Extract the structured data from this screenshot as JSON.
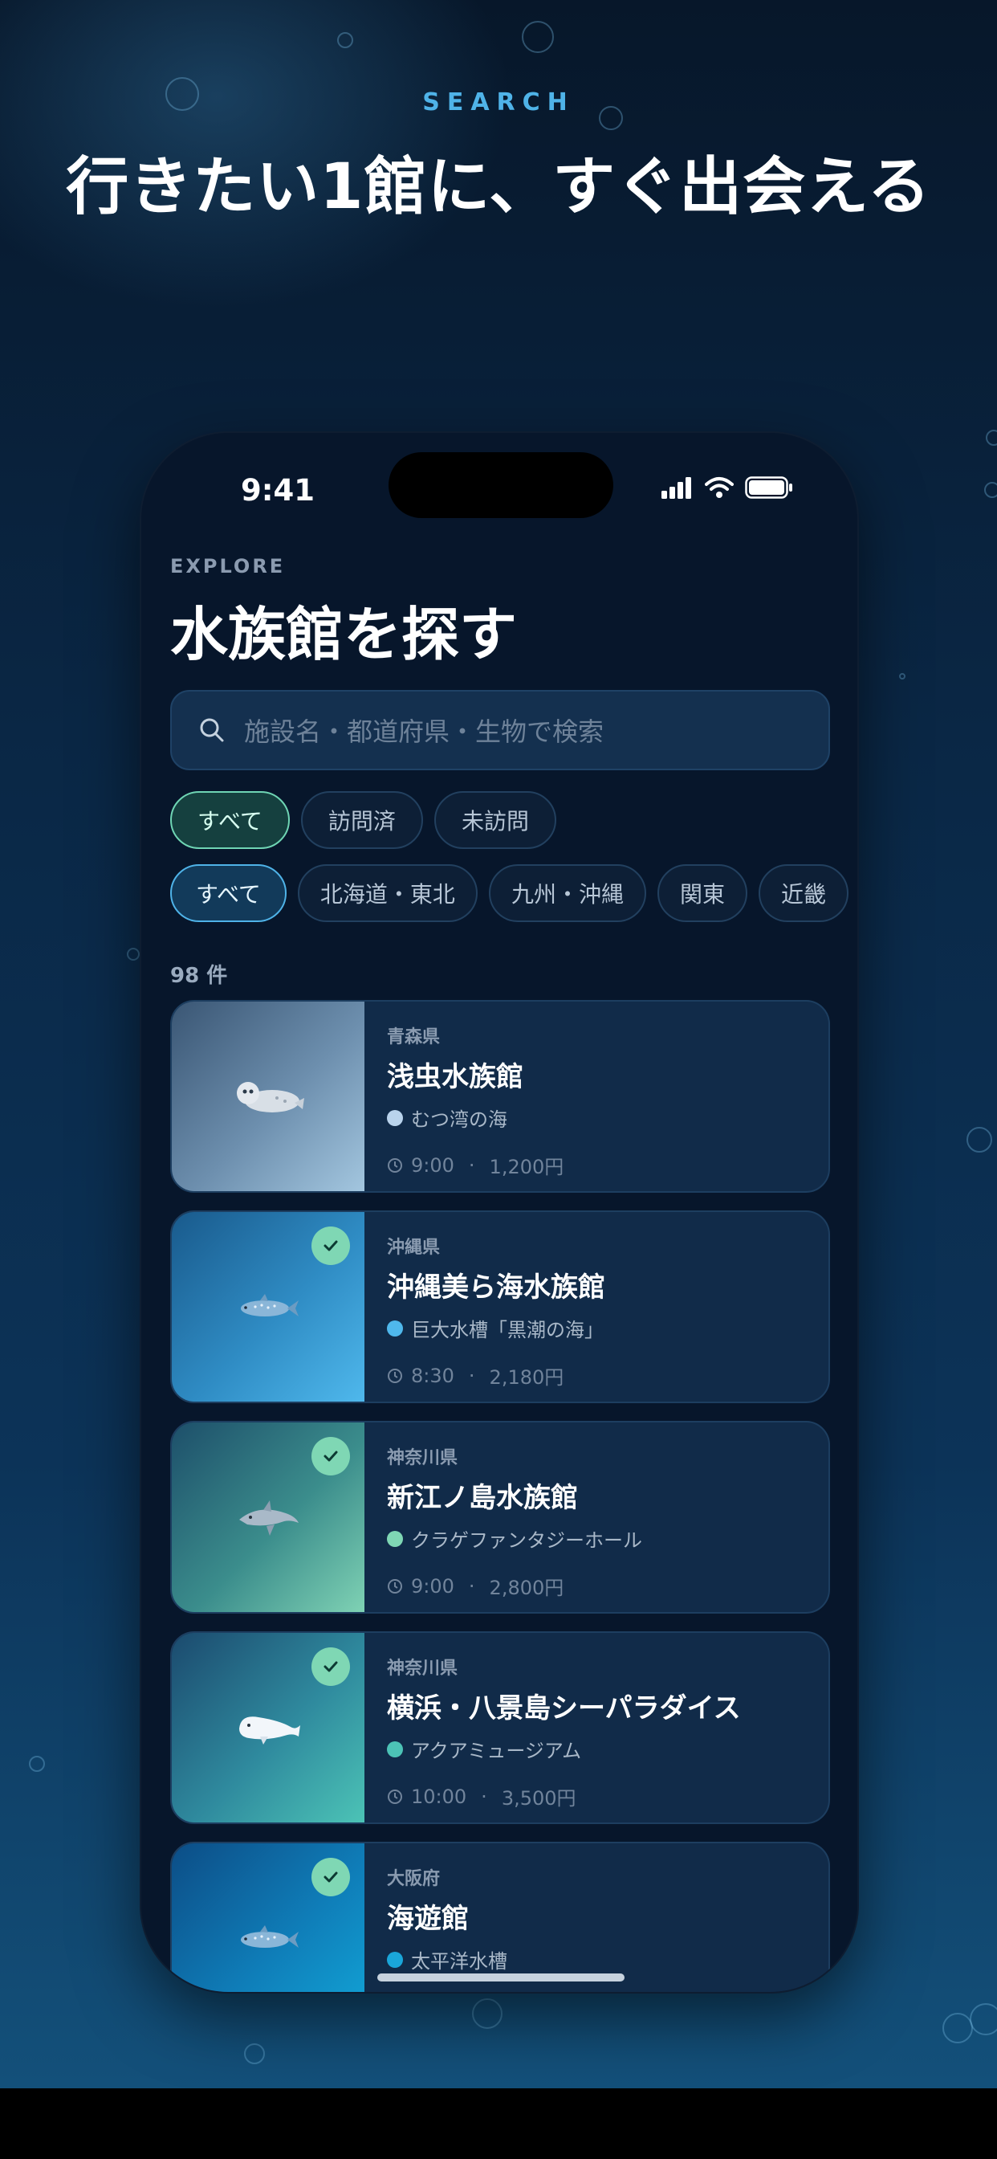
{
  "marketing": {
    "eyebrow": "SEARCH",
    "headline": "行きたい1館に、すぐ出会える"
  },
  "status_bar": {
    "time": "9:41"
  },
  "header": {
    "eyebrow": "EXPLORE",
    "title": "水族館を探す"
  },
  "search": {
    "placeholder": "施設名・都道府県・生物で検索"
  },
  "visit_filters": [
    {
      "label": "すべて",
      "active": true
    },
    {
      "label": "訪問済",
      "active": false
    },
    {
      "label": "未訪問",
      "active": false
    }
  ],
  "region_filters": [
    {
      "label": "すべて",
      "active": true
    },
    {
      "label": "北海道・東北",
      "active": false
    },
    {
      "label": "九州・沖縄",
      "active": false
    },
    {
      "label": "関東",
      "active": false
    },
    {
      "label": "近畿",
      "active": false
    }
  ],
  "results_count": "98 件",
  "aquariums": [
    {
      "prefecture": "青森県",
      "name": "浅虫水族館",
      "feature": "むつ湾の海",
      "hours": "9:00",
      "price": "1,200円",
      "visited": false,
      "animal": "seal-icon",
      "dot_color": "#b9d3ec"
    },
    {
      "prefecture": "沖縄県",
      "name": "沖縄美ら海水族館",
      "feature": "巨大水槽「黒潮の海」",
      "hours": "8:30",
      "price": "2,180円",
      "visited": true,
      "animal": "whale-shark-icon",
      "dot_color": "#4fb8ec"
    },
    {
      "prefecture": "神奈川県",
      "name": "新江ノ島水族館",
      "feature": "クラゲファンタジーホール",
      "hours": "9:00",
      "price": "2,800円",
      "visited": true,
      "animal": "dolphin-icon",
      "dot_color": "#7fd7b4"
    },
    {
      "prefecture": "神奈川県",
      "name": "横浜・八景島シーパラダイス",
      "feature": "アクアミュージアム",
      "hours": "10:00",
      "price": "3,500円",
      "visited": true,
      "animal": "beluga-icon",
      "dot_color": "#4cc3b6"
    },
    {
      "prefecture": "大阪府",
      "name": "海遊館",
      "feature": "太平洋水槽",
      "hours": "",
      "price": "",
      "visited": true,
      "animal": "whale-shark-icon",
      "dot_color": "#1aa6d9"
    }
  ],
  "colors": {
    "accent_blue": "#4fb3e8",
    "accent_green": "#7fd7b4",
    "background": "#07162b"
  }
}
